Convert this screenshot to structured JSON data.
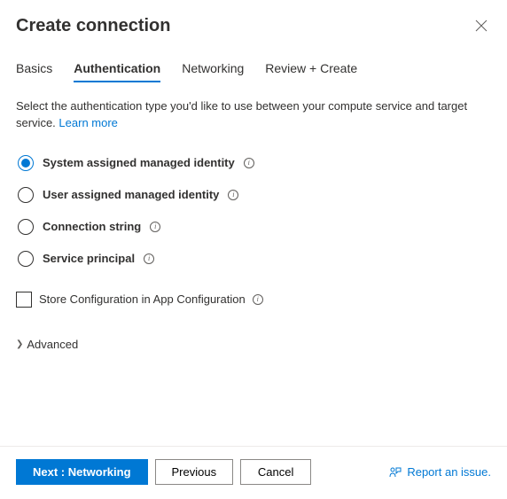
{
  "header": {
    "title": "Create connection"
  },
  "tabs": [
    {
      "label": "Basics",
      "active": false
    },
    {
      "label": "Authentication",
      "active": true
    },
    {
      "label": "Networking",
      "active": false
    },
    {
      "label": "Review + Create",
      "active": false
    }
  ],
  "description": {
    "text": "Select the authentication type you'd like to use between your compute service and target service.",
    "learn_more": "Learn more"
  },
  "auth_options": [
    {
      "label": "System assigned managed identity",
      "checked": true
    },
    {
      "label": "User assigned managed identity",
      "checked": false
    },
    {
      "label": "Connection string",
      "checked": false
    },
    {
      "label": "Service principal",
      "checked": false
    }
  ],
  "store_config": {
    "label": "Store Configuration in App Configuration",
    "checked": false
  },
  "advanced": {
    "label": "Advanced"
  },
  "footer": {
    "next": "Next : Networking",
    "previous": "Previous",
    "cancel": "Cancel",
    "report": "Report an issue."
  }
}
